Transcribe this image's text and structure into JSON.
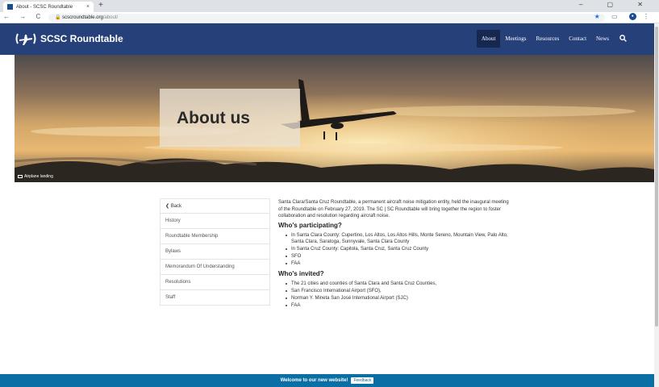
{
  "browser": {
    "tab_title": "About - SCSC Roundtable",
    "tab_close": "×",
    "new_tab": "+",
    "window_controls": "– ▢ ✕",
    "nav_buttons": "← → C",
    "url_host": "scscroundtable.org",
    "url_path": "/about/",
    "star_icon": "★"
  },
  "header": {
    "logo_text": "SCSC Roundtable",
    "nav": [
      {
        "label": "About",
        "active": true
      },
      {
        "label": "Meetings"
      },
      {
        "label": "Resources"
      },
      {
        "label": "Contact"
      },
      {
        "label": "News"
      }
    ]
  },
  "hero": {
    "title": "About us",
    "caption": "Airplane landing"
  },
  "sidebar": {
    "items": [
      {
        "label": "Back"
      },
      {
        "label": "History"
      },
      {
        "label": "Roundtable Membership"
      },
      {
        "label": "Bylaws"
      },
      {
        "label": "Memorandum Of Understanding"
      },
      {
        "label": "Resolutions"
      },
      {
        "label": "Staff"
      }
    ]
  },
  "content": {
    "intro": "Santa Clara/Santa Cruz Roundtable, a permanent aircraft noise mitigation entity, held the inaugural meeting of the Roundtable on February 27, 2019. The SC | SC Roundtable will bring together the region to foster collaboration and resolution regarding aircraft noise.",
    "participating_heading": "Who's participating?",
    "participating": [
      "In Santa Clara County: Cupertino, Los Altos, Los Altos Hills, Monte Sereno, Mountain View, Palo Alto, Santa Clara, Saratoga, Sunnyvale, Santa Clara County",
      "In Santa Cruz County: Capitola, Santa Cruz, Santa Cruz County",
      "SFO",
      "FAA"
    ],
    "invited_heading": "Who's invited?",
    "invited": [
      "The 21 cities and counties of Santa Clara and Santa Cruz Counties,",
      "San Francisco International Airport (SFO),",
      "Norman Y. Mineta San José International Airport (SJC)",
      "FAA"
    ]
  },
  "footer": {
    "message": "Welcome to our new website!",
    "feedback": "Feedback"
  },
  "colors": {
    "header_bg": "#26407a",
    "footer_bg": "#0b6fa6"
  }
}
